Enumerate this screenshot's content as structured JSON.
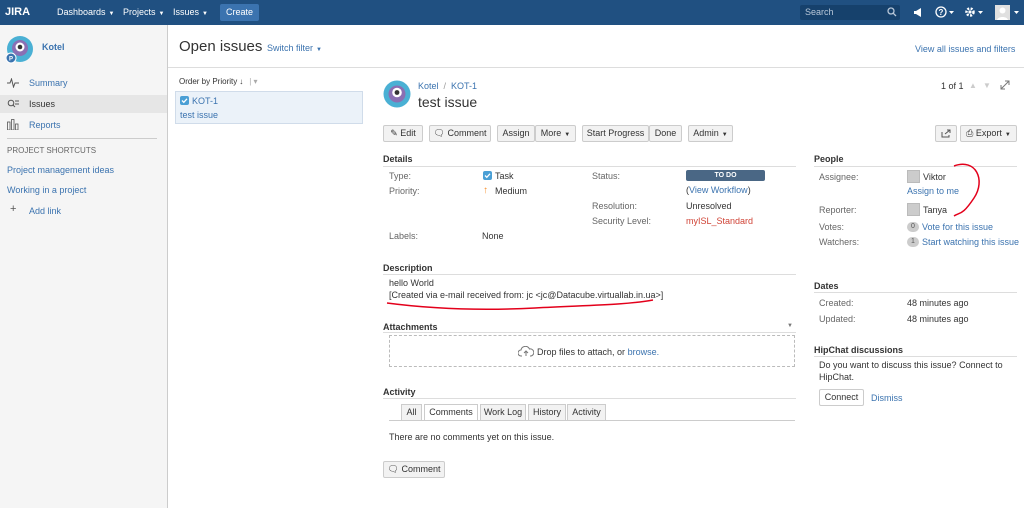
{
  "topnav": {
    "logo": "JIRA",
    "dashboards": "Dashboards",
    "projects": "Projects",
    "issues": "Issues",
    "create": "Create",
    "search_placeholder": "Search"
  },
  "sidebar": {
    "project_name": "Kotel",
    "items": [
      {
        "label": "Summary"
      },
      {
        "label": "Issues"
      },
      {
        "label": "Reports"
      }
    ],
    "shortcuts_title": "PROJECT SHORTCUTS",
    "shortcuts": [
      "Project management ideas",
      "Working in a project"
    ],
    "add_link": "Add link"
  },
  "header": {
    "title": "Open issues",
    "switch_filter": "Switch filter",
    "view_all": "View all issues and filters"
  },
  "issuelist": {
    "order_by": "Order by Priority",
    "items": [
      {
        "key": "KOT-1",
        "summary": "test issue"
      }
    ]
  },
  "issue": {
    "project": "Kotel",
    "key": "KOT-1",
    "summary": "test issue",
    "pager": "1 of 1"
  },
  "toolbar": {
    "edit": "Edit",
    "comment": "Comment",
    "assign": "Assign",
    "more": "More",
    "start_progress": "Start Progress",
    "done": "Done",
    "admin": "Admin",
    "export": "Export"
  },
  "details": {
    "title": "Details",
    "type_label": "Type:",
    "type": "Task",
    "priority_label": "Priority:",
    "priority": "Medium",
    "labels_label": "Labels:",
    "labels": "None",
    "status_label": "Status:",
    "status": "TO DO",
    "view_workflow": "View Workflow",
    "resolution_label": "Resolution:",
    "resolution": "Unresolved",
    "security_label": "Security Level:",
    "security": "myISL_Standard"
  },
  "description": {
    "title": "Description",
    "line1": "hello World",
    "line2": "[Created via e-mail received from: jc <jc@Datacube.virtuallab.in.ua>]"
  },
  "attachments": {
    "title": "Attachments",
    "drop_text": "Drop files to attach, or",
    "browse": "browse."
  },
  "activity": {
    "title": "Activity",
    "tabs": [
      "All",
      "Comments",
      "Work Log",
      "History",
      "Activity"
    ],
    "empty": "There are no comments yet on this issue.",
    "comment_button": "Comment"
  },
  "people": {
    "title": "People",
    "assignee_label": "Assignee:",
    "assignee": "Viktor",
    "assign_to_me": "Assign to me",
    "reporter_label": "Reporter:",
    "reporter": "Tanya",
    "votes_label": "Votes:",
    "votes_count": "0",
    "vote_link": "Vote for this issue",
    "watchers_label": "Watchers:",
    "watchers_count": "1",
    "watch_link": "Start watching this issue"
  },
  "dates": {
    "title": "Dates",
    "created_label": "Created:",
    "created": "48 minutes ago",
    "updated_label": "Updated:",
    "updated": "48 minutes ago"
  },
  "hipchat": {
    "title": "HipChat discussions",
    "text1": "Do you want to discuss this issue? Connect to",
    "text2": "HipChat.",
    "connect": "Connect",
    "dismiss": "Dismiss"
  },
  "colors": {
    "nav": "#205081",
    "link": "#3b73af",
    "todo": "#4a6785",
    "annotation": "#e3001b"
  }
}
